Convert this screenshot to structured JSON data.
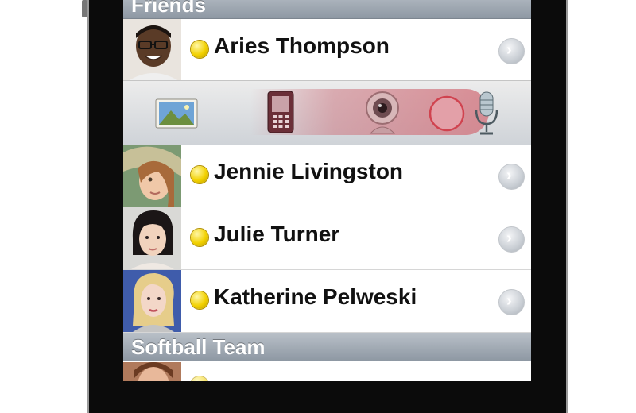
{
  "sections": [
    {
      "title": "Friends"
    },
    {
      "title": "Softball Team"
    }
  ],
  "contacts": [
    {
      "name": "Aries Thompson",
      "status": "away"
    },
    {
      "name": "Jennie Livingston",
      "status": "away"
    },
    {
      "name": "Julie Turner",
      "status": "away"
    },
    {
      "name": "Katherine Pelweski",
      "status": "away"
    }
  ],
  "action_bar": {
    "icons": [
      "photo-icon",
      "phone-icon",
      "webcam-icon",
      "record-icon",
      "microphone-icon"
    ]
  },
  "colors": {
    "status_away": "#f2d100",
    "header_bg": "#9aa3ad",
    "accent_red": "#d0434f"
  },
  "disclosure_glyph": "›"
}
